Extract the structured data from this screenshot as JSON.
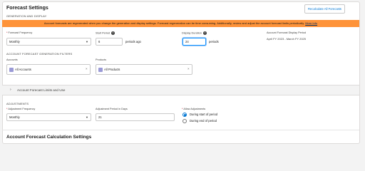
{
  "header": {
    "title": "Forecast Settings",
    "recalc_label": "Recalculate All Forecasts"
  },
  "generation": {
    "section_title": "GENERATION AND DISPLAY",
    "banner_text": "Account forecasts are regenerated when you change the generation and display settings. Forecast regeneration can be time consuming. Additionally, review and adjust the account forecast limits periodically.",
    "banner_link": "More Info",
    "frequency_label": "Forecast Frequency",
    "frequency_value": "Monthly",
    "start_period_label": "Start Period",
    "start_period_value": "6",
    "start_period_suffix": "periods ago",
    "display_duration_label": "Display Duration",
    "display_duration_value": "24",
    "display_duration_suffix": "periods",
    "display_period_label": "Account Forecast Display Period",
    "display_period_value": "April FY 2023 - March FY 2025"
  },
  "filters": {
    "section_title": "ACCOUNT FORECAST GENERATION FILTERS",
    "accounts_label": "Accounts",
    "accounts_value": "All Accounts",
    "products_label": "Products",
    "products_value": "All Products"
  },
  "limits": {
    "label": "Account Forecast Limits and Use"
  },
  "adjustments": {
    "section_title": "ADJUSTMENTS",
    "frequency_label": "Adjustment Frequency",
    "frequency_value": "Monthly",
    "period_label": "Adjustment Period in Days",
    "period_value": "21",
    "allow_label": "Allow Adjustments",
    "options": [
      "During start of period",
      "During end of period"
    ],
    "selected_index": 0
  },
  "calc": {
    "title": "Account Forecast Calculation Settings"
  },
  "colors": {
    "banner": "#fe9339",
    "accent": "#0176d3",
    "required": "#ba0517"
  }
}
